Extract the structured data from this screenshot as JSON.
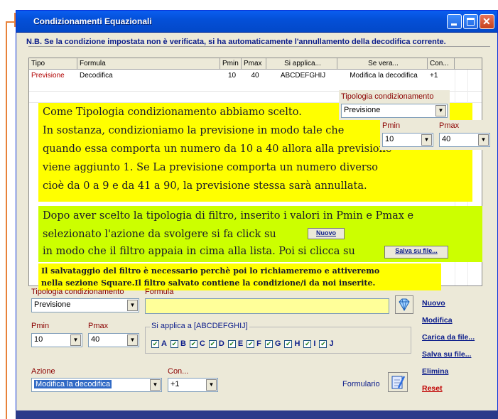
{
  "window": {
    "title": "Condizionamenti Equazionali",
    "note": "N.B. Se la condizione impostata non è verificata, si ha automaticamente l'annullamento della decodifica corrente."
  },
  "table": {
    "headers": [
      "Tipo",
      "Formula",
      "Pmin",
      "Pmax",
      "Si applica...",
      "Se vera...",
      "Con..."
    ],
    "rows": [
      [
        "Previsione",
        "Decodifica",
        "10",
        "40",
        "ABCDEFGHIJ",
        "Modifica la decodifica",
        "+1"
      ]
    ]
  },
  "overlay": {
    "tipologia_label": "Tipologia condizionamento",
    "tipologia_value": "Previsione",
    "pmin_label": "Pmin",
    "pmax_label": "Pmax",
    "pmin_value": "10",
    "pmax_value": "40",
    "p1_line1": "Come Tipologia condizionamento abbiamo scelto.",
    "p1_line2": "In sostanza, condizioniamo la previsione in modo tale che",
    "p1_line3": "quando essa comporta un numero da 10 a 40 allora alla previsione",
    "p1_line4": "viene  aggiunto 1. Se La previsione comporta un numero diverso",
    "p1_line5": "cioè da 0 a 9 e da 41 a 90, la previsione stessa sarà annullata.",
    "p2_line1": "Dopo aver scelto la tipologia di filtro, inserito i valori in Pmin e Pmax e",
    "p2_line2": "selezionato l'azione da svolgere si fa click su",
    "p2_line3": "in modo che il filtro appaia in cima alla lista. Poi si clicca su",
    "nuovo_btn": "Nuovo",
    "salva_btn": "Salva su file...",
    "p3_line1": "Il salvataggio del filtro è necessario perchè poi lo richiameremo e attiveremo",
    "p3_line2": "nella sezione Square.Il filtro salvato contiene la condizione/i da noi inserite."
  },
  "form": {
    "tipologia_label": "Tipologia condizionamento",
    "tipologia_value": "Previsione",
    "formula_label": "Formula",
    "formula_value": "",
    "pmin_label": "Pmin",
    "pmin_value": "10",
    "pmax_label": "Pmax",
    "pmax_value": "40",
    "si_applica_label": "Si applica a [ABCDEFGHIJ]",
    "checks": [
      "A",
      "B",
      "C",
      "D",
      "E",
      "F",
      "G",
      "H",
      "I",
      "J"
    ],
    "azione_label": "Azione",
    "azione_value": "Modifica la decodifica",
    "con_label": "Con...",
    "con_value": "+1",
    "formulario_label": "Formulario"
  },
  "actions": {
    "nuovo": "Nuovo",
    "modifica": "Modifica",
    "carica": "Carica da file...",
    "salva": "Salva su file...",
    "elimina": "Elimina",
    "reset": "Reset"
  }
}
